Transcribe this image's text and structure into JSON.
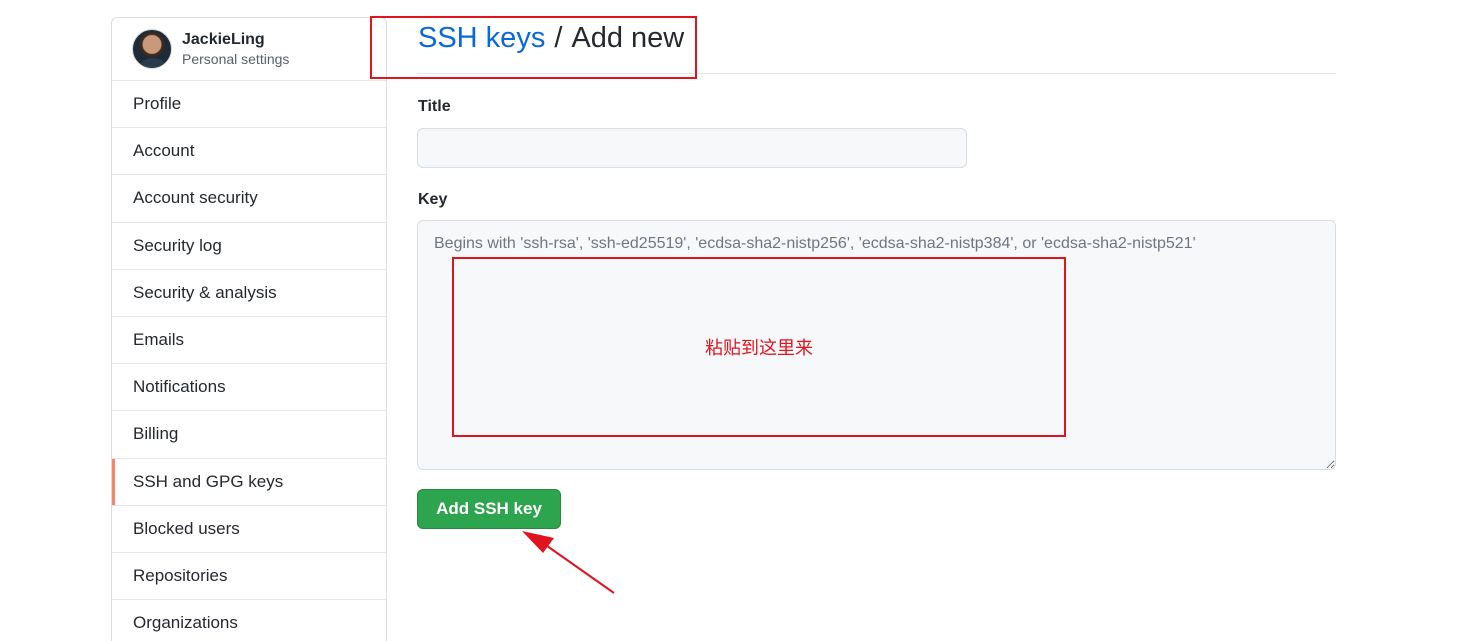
{
  "user": {
    "name": "JackieLing",
    "subtitle": "Personal settings"
  },
  "sidebar": {
    "items": [
      {
        "label": "Profile"
      },
      {
        "label": "Account"
      },
      {
        "label": "Account security"
      },
      {
        "label": "Security log"
      },
      {
        "label": "Security & analysis"
      },
      {
        "label": "Emails"
      },
      {
        "label": "Notifications"
      },
      {
        "label": "Billing"
      },
      {
        "label": "SSH and GPG keys",
        "selected": true
      },
      {
        "label": "Blocked users"
      },
      {
        "label": "Repositories"
      },
      {
        "label": "Organizations"
      }
    ]
  },
  "breadcrumb": {
    "link": "SSH keys",
    "separator": "/",
    "current": "Add new"
  },
  "form": {
    "title_label": "Title",
    "title_value": "",
    "key_label": "Key",
    "key_placeholder": "Begins with 'ssh-rsa', 'ssh-ed25519', 'ecdsa-sha2-nistp256', 'ecdsa-sha2-nistp384', or 'ecdsa-sha2-nistp521'",
    "submit_label": "Add SSH key"
  },
  "annotation": {
    "paste_note": "粘贴到这里来",
    "color": "#e0141e"
  },
  "colors": {
    "link": "#0969da",
    "button": "#2da44e",
    "selected_indicator": "#f9826c"
  }
}
